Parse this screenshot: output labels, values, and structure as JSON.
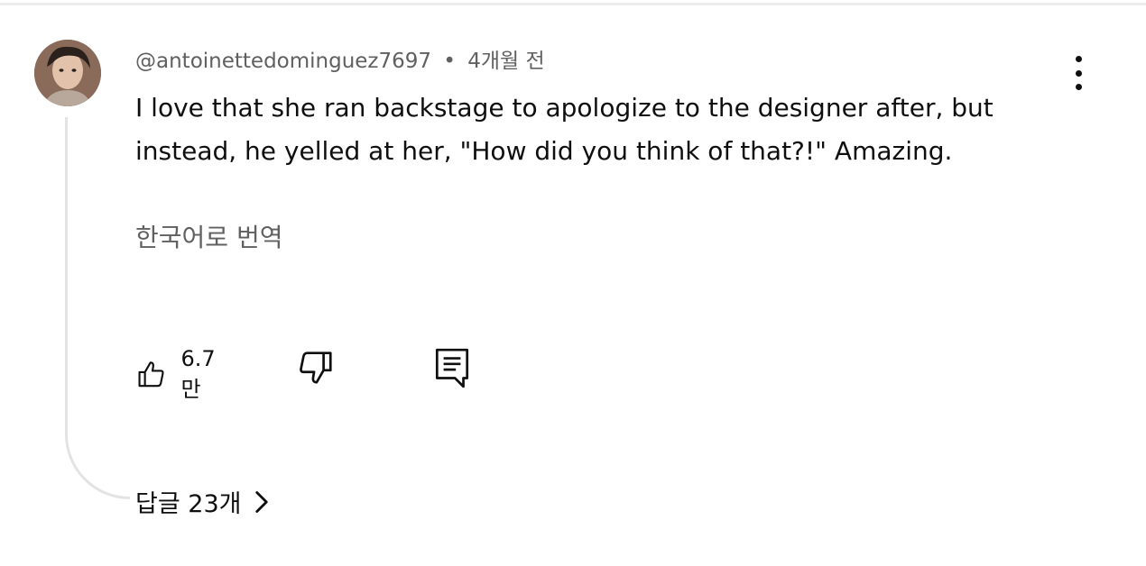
{
  "comment": {
    "author": "@antoinettedominguez7697",
    "separator": "•",
    "time_ago": "4개월 전",
    "text": "I love that she ran backstage to apologize to the designer after, but instead, he yelled at her, \"How did you think of that?!\" Amazing.",
    "translate_label": "한국어로 번역",
    "like_count": "6.7만",
    "replies_label": "답글 23개"
  },
  "icons": {
    "more": "more-vert-icon",
    "like": "thumb-up-icon",
    "dislike": "thumb-down-icon",
    "reply": "comment-icon",
    "replies_chevron": "chevron-right-icon"
  },
  "colors": {
    "text_primary": "#0f0f0f",
    "text_secondary": "#606060",
    "thread_line": "#e3e3e3",
    "divider": "#ececec"
  }
}
